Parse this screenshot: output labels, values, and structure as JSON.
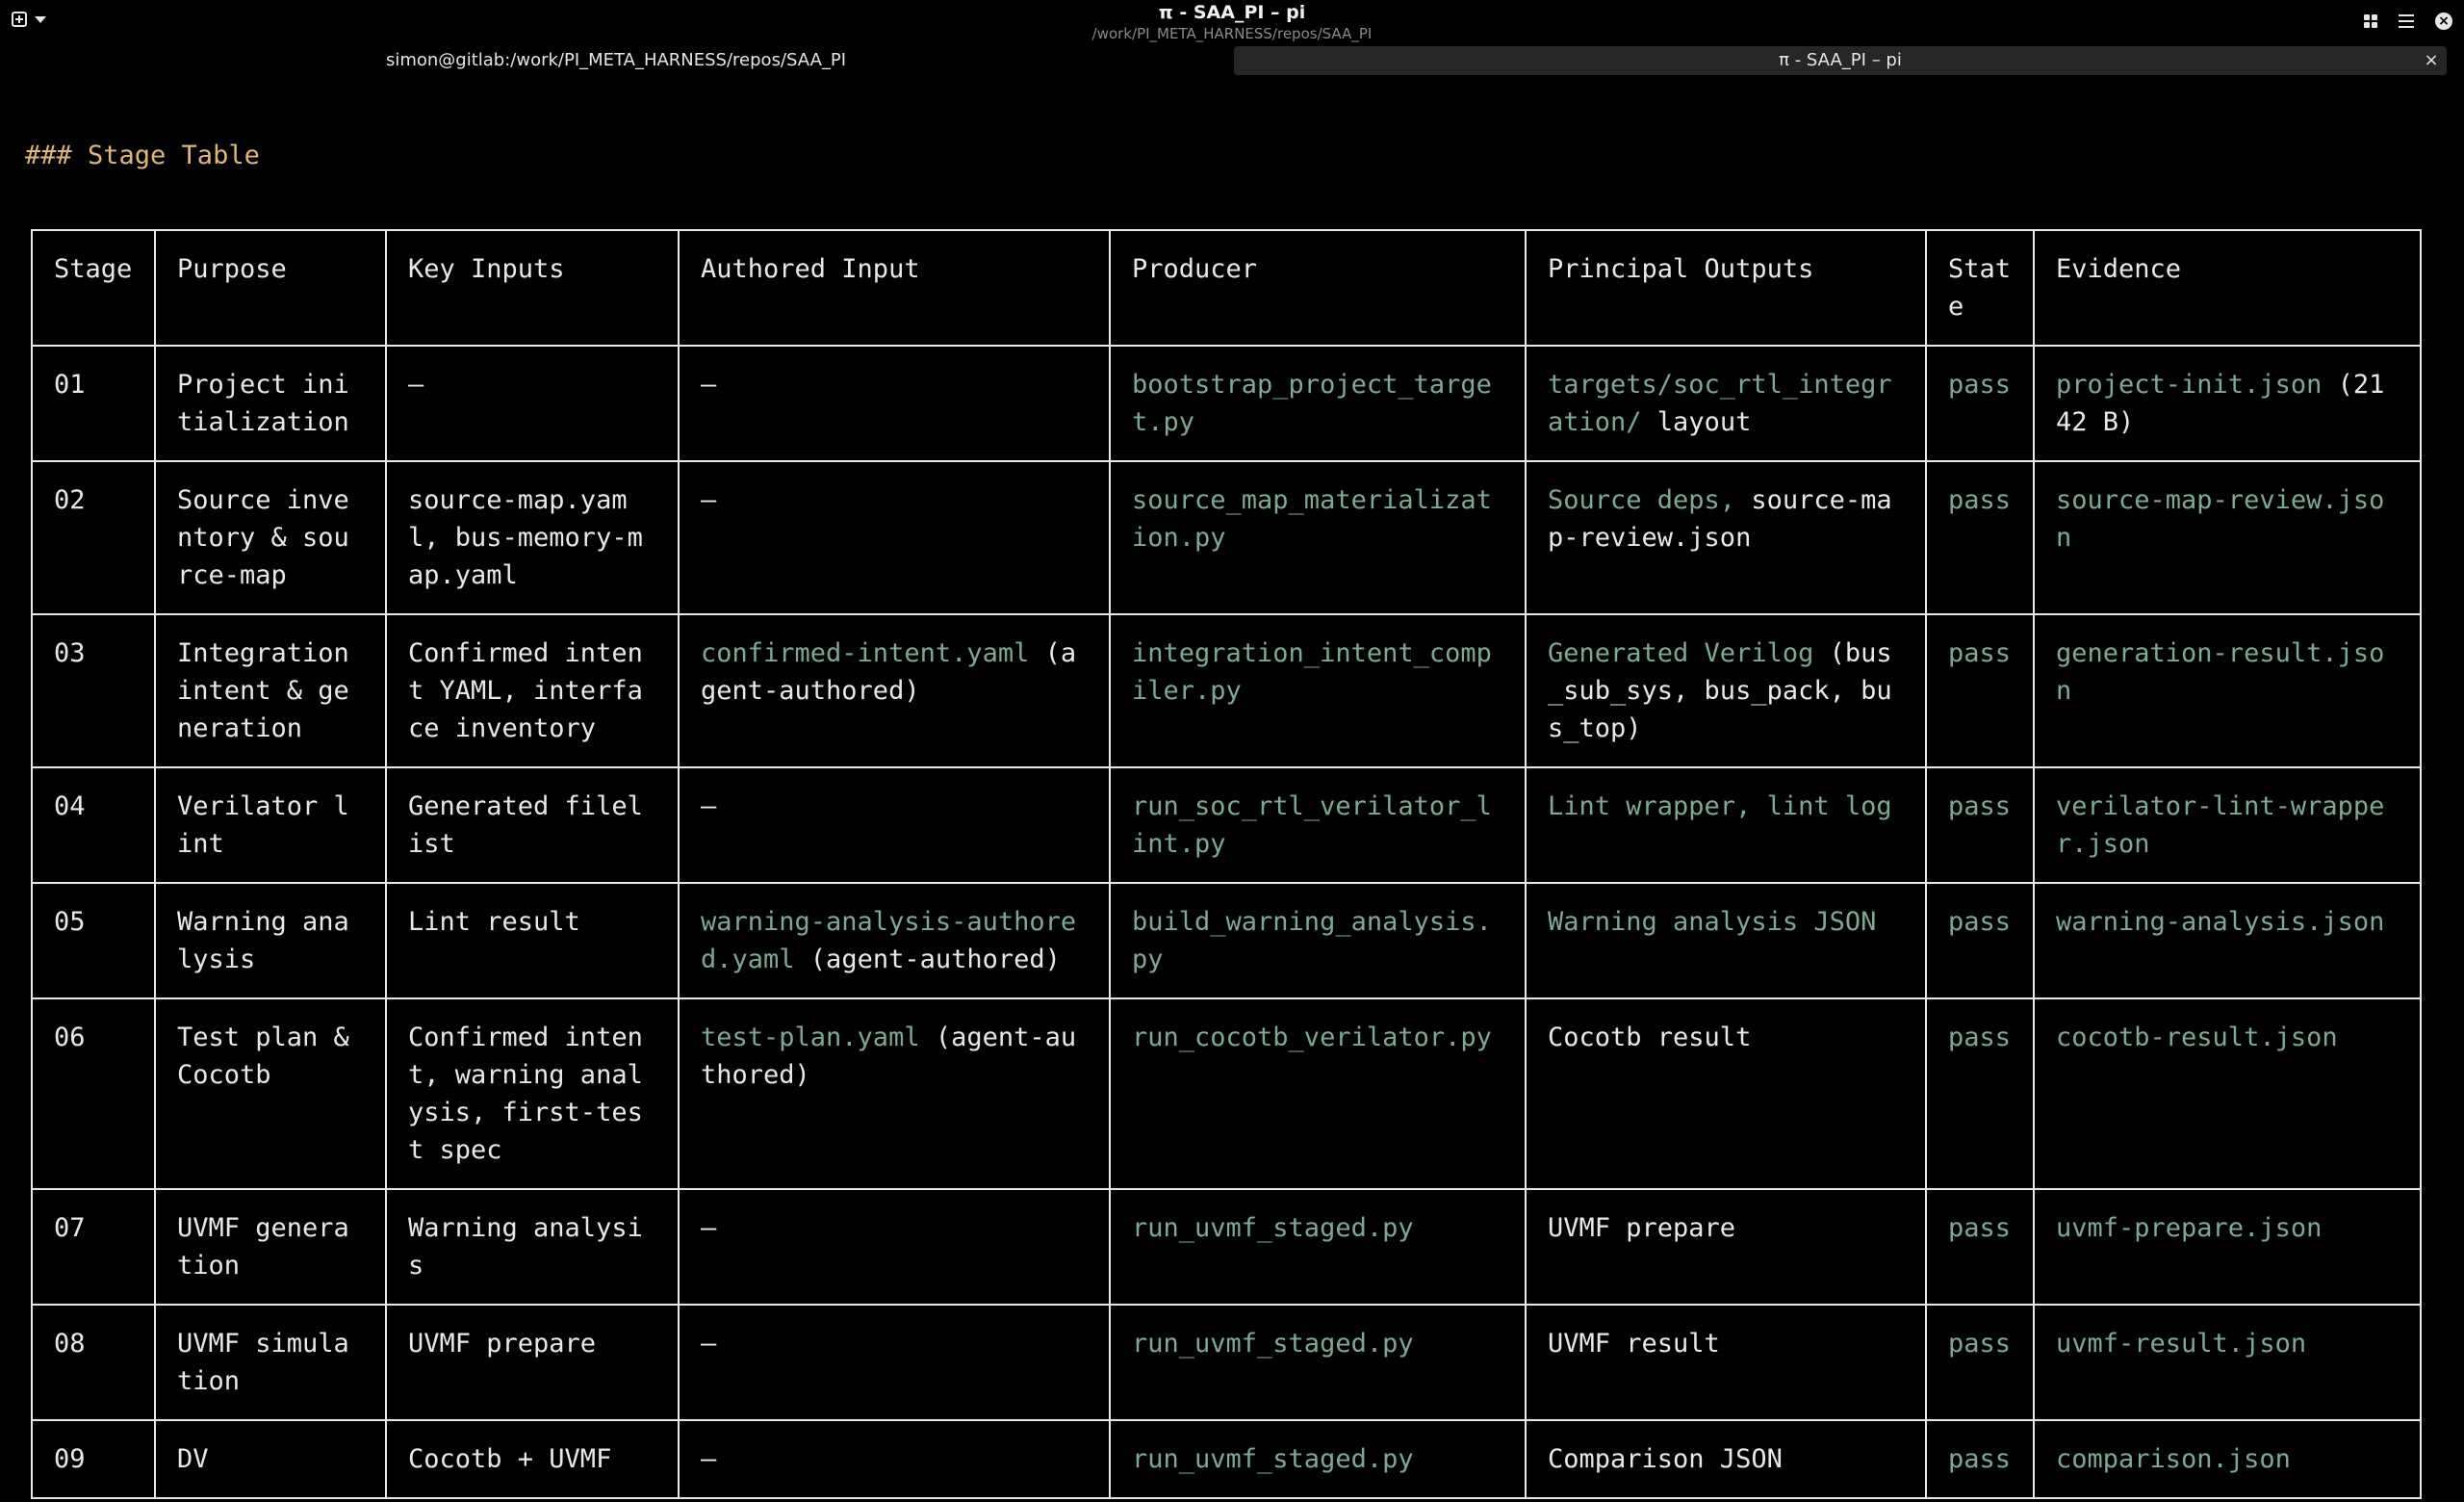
{
  "window": {
    "title": "π - SAA_PI – pi",
    "subtitle": "/work/PI_META_HARNESS/repos/SAA_PI",
    "close_glyph": "×"
  },
  "tabs": [
    {
      "label": "simon@gitlab:/work/PI_META_HARNESS/repos/SAA_PI"
    },
    {
      "label": "π - SAA_PI – pi",
      "close_glyph": "×"
    }
  ],
  "heading": "### Stage Table",
  "table": {
    "headers": [
      "Stage",
      "Purpose",
      "Key Inputs",
      "Authored Input",
      "Producer",
      "Principal Outputs",
      "State",
      "Evidence"
    ],
    "rows": [
      {
        "stage": "01",
        "purpose": "Project initialization",
        "inputs": "—",
        "authored": "—",
        "authored_note": "",
        "producer": "bootstrap_project_target.py",
        "outputs_file": "targets/soc_rtl_integration/",
        "outputs_text": " layout",
        "state": "pass",
        "evidence_file": "project-init.json",
        "evidence_text": " (2142 B)"
      },
      {
        "stage": "02",
        "purpose": "Source inventory & source-map",
        "inputs": "source-map.yaml, bus-memory-map.yaml",
        "authored": "—",
        "authored_note": "",
        "producer": "source_map_materialization.py",
        "outputs_file": "Source deps,",
        "outputs_text": " source-map-review.json",
        "state": "pass",
        "evidence_file": "source-map-review.json",
        "evidence_text": ""
      },
      {
        "stage": "03",
        "purpose": "Integration intent & generation",
        "inputs": "Confirmed intent YAML, interface inventory",
        "authored": "confirmed-intent.yaml",
        "authored_note": " (agent-authored)",
        "producer": "integration_intent_compiler.py",
        "outputs_file": "Generated Verilog",
        "outputs_text": " (bus_sub_sys, bus_pack, bus_top)",
        "state": "pass",
        "evidence_file": "generation-result.json",
        "evidence_text": ""
      },
      {
        "stage": "04",
        "purpose": "Verilator lint",
        "inputs": "Generated filelist",
        "authored": "—",
        "authored_note": "",
        "producer": "run_soc_rtl_verilator_lint.py",
        "outputs_file": "Lint wrapper, lint log",
        "outputs_text": "",
        "state": "pass",
        "evidence_file": "verilator-lint-wrapper.json",
        "evidence_text": ""
      },
      {
        "stage": "05",
        "purpose": "Warning analysis",
        "inputs": "Lint result",
        "authored": "warning-analysis-authored.yaml",
        "authored_note": " (agent-authored)",
        "producer": "build_warning_analysis.py",
        "outputs_file": "Warning analysis JSON",
        "outputs_text": "",
        "state": "pass",
        "evidence_file": "warning-analysis.json",
        "evidence_text": ""
      },
      {
        "stage": "06",
        "purpose": "Test plan & Cocotb",
        "inputs": "Confirmed intent, warning analysis, first-test spec",
        "authored": "test-plan.yaml",
        "authored_note": " (agent-authored)",
        "producer": "run_cocotb_verilator.py",
        "outputs_file": "",
        "outputs_text": "Cocotb result",
        "state": "pass",
        "evidence_file": "cocotb-result.json",
        "evidence_text": ""
      },
      {
        "stage": "07",
        "purpose": "UVMF generation",
        "inputs": "Warning analysis",
        "authored": "—",
        "authored_note": "",
        "producer": "run_uvmf_staged.py",
        "outputs_file": "",
        "outputs_text": "UVMF prepare",
        "state": "pass",
        "evidence_file": "uvmf-prepare.json",
        "evidence_text": ""
      },
      {
        "stage": "08",
        "purpose": "UVMF simulation",
        "inputs": "UVMF prepare",
        "authored": "—",
        "authored_note": "",
        "producer": "run_uvmf_staged.py",
        "outputs_file": "",
        "outputs_text": "UVMF result",
        "state": "pass",
        "evidence_file": "uvmf-result.json",
        "evidence_text": ""
      },
      {
        "stage": "09",
        "purpose": "DV",
        "inputs": "Cocotb + UVMF",
        "authored": "—",
        "authored_note": "",
        "producer": "run_uvmf_staged.py",
        "outputs_file": "",
        "outputs_text": "Comparison JSON",
        "state": "pass",
        "evidence_file": "comparison.json",
        "evidence_text": ""
      }
    ]
  },
  "colors": {
    "background": "#000000",
    "text": "#e8e8e8",
    "heading": "#e1b679",
    "file": "#7fa893",
    "tab_active": "#262626"
  }
}
